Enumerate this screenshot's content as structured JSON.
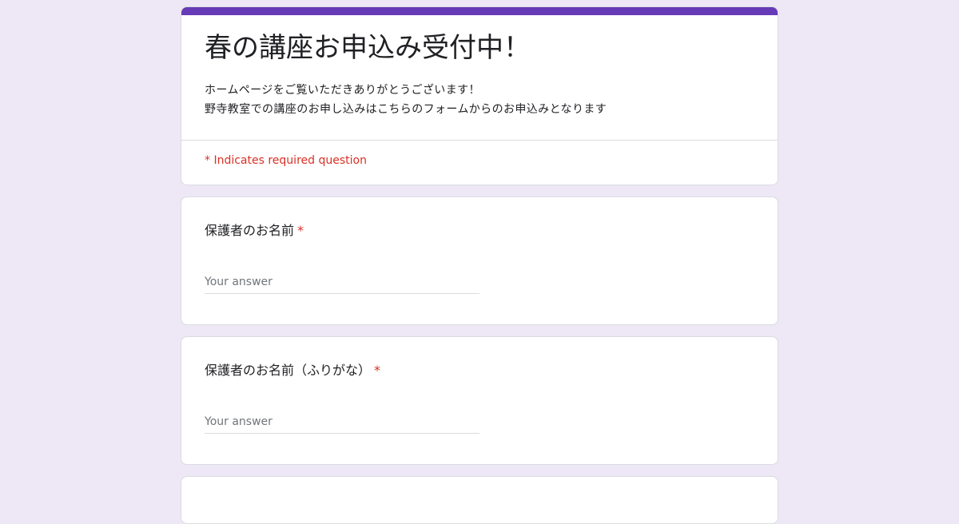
{
  "colors": {
    "background": "#ede7f6",
    "accent": "#673ab7",
    "required": "#d93025"
  },
  "header": {
    "title": "春の講座お申込み受付中！",
    "description_lines": [
      "ホームページをご覧いただきありがとうございます！",
      "野寺教室での講座のお申し込みはこちらのフォームからのお申込みとなります"
    ],
    "required_note": "* Indicates required question"
  },
  "questions": [
    {
      "title": "保護者のお名前",
      "required_marker": "*",
      "placeholder": "Your answer",
      "value": ""
    },
    {
      "title": "保護者のお名前（ふりがな）",
      "required_marker": "*",
      "placeholder": "Your answer",
      "value": ""
    }
  ]
}
